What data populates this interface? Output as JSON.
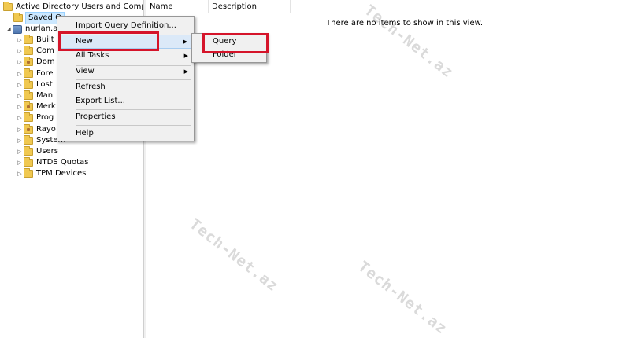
{
  "tree": {
    "root_label": "Active Directory Users and Computers",
    "saved_queries_label": "Saved Q",
    "domain_label": "nurlan.a",
    "items": [
      {
        "label": "Built",
        "icon": "folder-icon"
      },
      {
        "label": "Com",
        "icon": "folder-icon"
      },
      {
        "label": "Dom",
        "icon": "ou-folder-icon"
      },
      {
        "label": "Fore",
        "icon": "folder-icon"
      },
      {
        "label": "Lost",
        "icon": "folder-icon"
      },
      {
        "label": "Man",
        "icon": "folder-icon"
      },
      {
        "label": "Merk",
        "icon": "ou-folder-icon"
      },
      {
        "label": "Prog",
        "icon": "folder-icon"
      },
      {
        "label": "Rayo",
        "icon": "ou-folder-icon"
      },
      {
        "label": "System",
        "icon": "folder-icon"
      },
      {
        "label": "Users",
        "icon": "folder-icon"
      },
      {
        "label": "NTDS Quotas",
        "icon": "folder-icon"
      },
      {
        "label": "TPM Devices",
        "icon": "folder-icon"
      }
    ]
  },
  "list": {
    "columns": [
      "Name",
      "Description"
    ],
    "empty_message": "There are no items to show in this view."
  },
  "context_menu": {
    "items": [
      {
        "label": "Import Query Definition...",
        "submenu": false
      },
      {
        "label": "New",
        "submenu": true,
        "hover": true
      },
      {
        "label": "All Tasks",
        "submenu": true
      },
      {
        "label": "View",
        "submenu": true
      },
      {
        "label": "Refresh",
        "submenu": false
      },
      {
        "label": "Export List...",
        "submenu": false
      },
      {
        "label": "Properties",
        "submenu": false
      },
      {
        "label": "Help",
        "submenu": false
      }
    ]
  },
  "new_submenu": {
    "items": [
      {
        "label": "Query"
      },
      {
        "label": "Folder"
      }
    ]
  },
  "watermark": "Tech-Net.az",
  "colors": {
    "highlight": "#d5142a",
    "selection": "#cce8ff",
    "menu_bg": "#f0f0f0"
  }
}
